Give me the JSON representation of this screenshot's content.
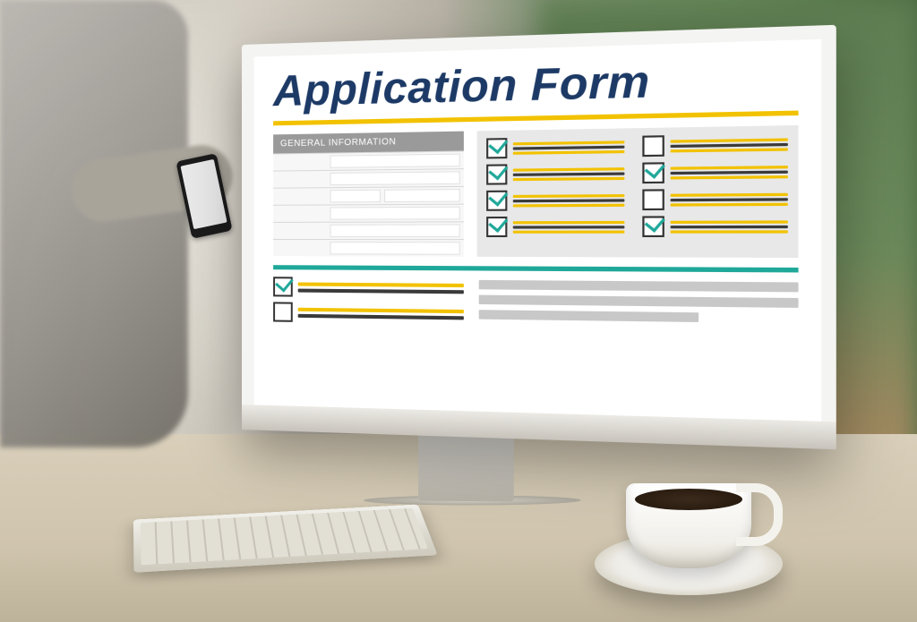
{
  "screen": {
    "title": "Application Form",
    "general_info_header": "GENERAL INFORMATION",
    "checklist_left": [
      true,
      true,
      true,
      true
    ],
    "checklist_right": [
      false,
      true,
      false,
      true
    ],
    "bottom_checklist": [
      true,
      false
    ]
  }
}
